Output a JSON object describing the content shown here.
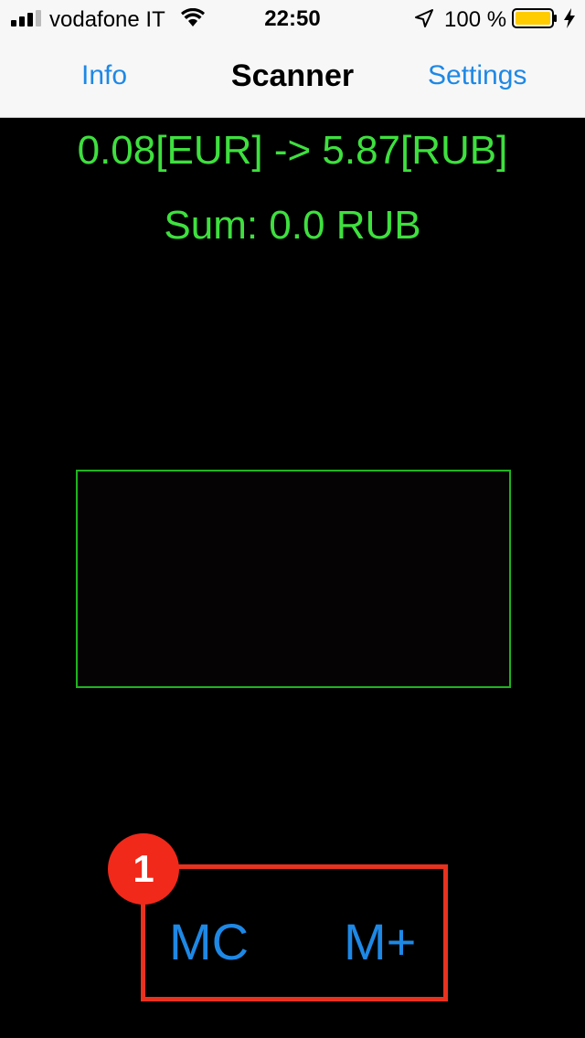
{
  "status_bar": {
    "carrier": "vodafone IT",
    "time": "22:50",
    "battery_percent": "100 %",
    "signal_bars": 3,
    "battery_color": "#ffcc00"
  },
  "nav": {
    "left_label": "Info",
    "title": "Scanner",
    "right_label": "Settings",
    "accent_color": "#1e88e5"
  },
  "main": {
    "conversion_text": "0.08[EUR] -> 5.87[RUB]",
    "sum_text": "Sum: 0.0 RUB",
    "text_color": "#3ee03e"
  },
  "memory": {
    "clear_label": "MC",
    "add_label": "M+"
  },
  "annotation": {
    "badge_number": "1",
    "color": "#e8321e"
  }
}
